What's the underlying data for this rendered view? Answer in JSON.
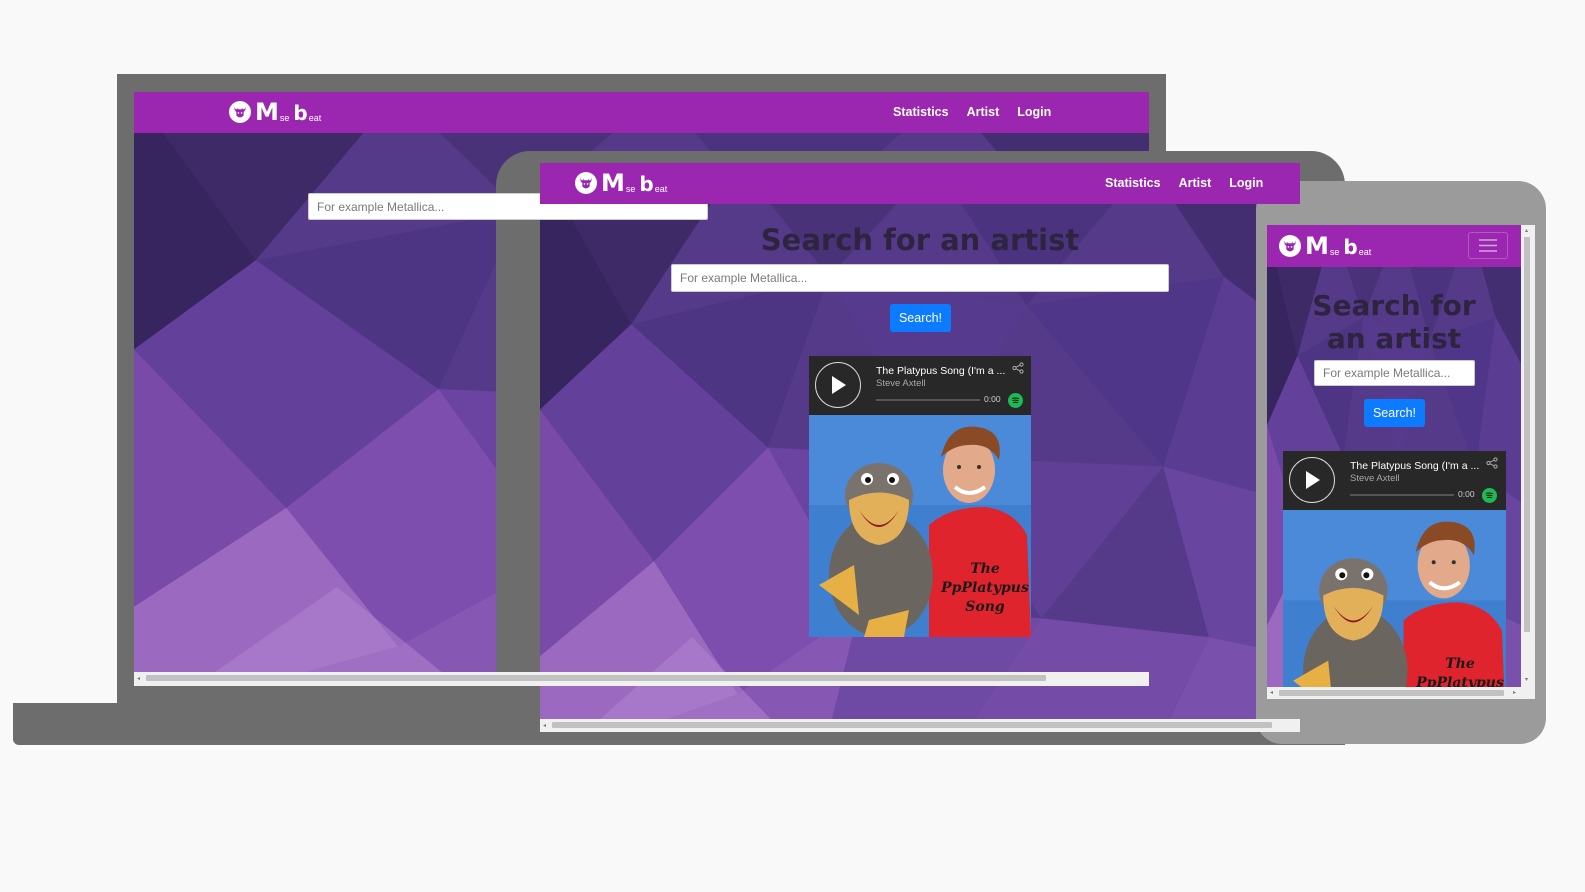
{
  "brand": {
    "logo_big": "M",
    "logo_small": "se",
    "logo_b": "b",
    "logo_small_2": "eat"
  },
  "nav": {
    "statistics": "Statistics",
    "artist": "Artist",
    "login": "Login"
  },
  "search": {
    "heading": "Search for an artist",
    "heading_line1": "Search for",
    "heading_line2": "an artist",
    "placeholder": "For example Metallica...",
    "button": "Search!"
  },
  "player": {
    "title": "The Platypus Song (I'm a ...",
    "artist": "Steve Axtell",
    "time": "0:00",
    "progress": 0
  },
  "cover_art": {
    "shirt_text_1": "The",
    "shirt_text_2": "PpPlatypus",
    "shirt_text_3": "Song"
  },
  "colors": {
    "navbar": "#9b27b0",
    "background": "#5a3a8e",
    "button": "#0d7bff",
    "device_frame": "#6d6d6d",
    "phone_frame": "#9b9b9b",
    "spotify_green": "#1db954"
  },
  "icons": {
    "logo": "moose-icon",
    "play": "play-icon",
    "share": "share-icon",
    "spotify": "spotify-icon",
    "menu": "hamburger-menu-icon"
  }
}
